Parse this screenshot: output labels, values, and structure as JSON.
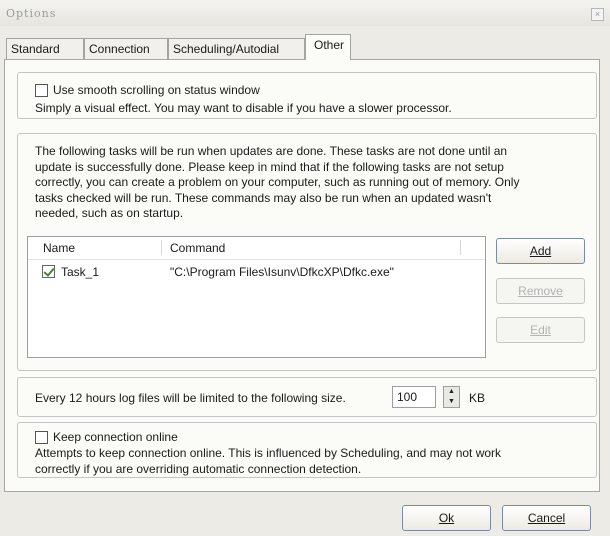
{
  "window": {
    "title": "Options",
    "close_glyph": "×"
  },
  "tabs": [
    {
      "label": "Standard"
    },
    {
      "label": "Connection"
    },
    {
      "label": "Scheduling/Autodial"
    },
    {
      "label": "Other",
      "active": true
    }
  ],
  "smooth_scroll": {
    "label": "Use smooth scrolling on status window",
    "checked": false,
    "description": "Simply a visual effect.  You may want to disable if you have a slower processor."
  },
  "tasks": {
    "description_1": "The following tasks will be run when updates are done.  These tasks are not done until an",
    "description_2": "update is successfully done.  Please keep in mind that if the following tasks are not setup",
    "description_3": "correctly, you can create a problem on your computer, such as running out of memory.  Only",
    "description_4": "tasks checked will be run.  These commands may also be run when an updated wasn't",
    "description_5": "needed, such as on startup.",
    "columns": {
      "name": "Name",
      "command": "Command"
    },
    "rows": [
      {
        "name": "Task_1",
        "command": "\"C:\\Program Files\\Isunv\\DfkcXP\\Dfkc.exe\"",
        "checked": true
      }
    ],
    "buttons": {
      "add": "Add",
      "remove": "Remove",
      "edit": "Edit"
    }
  },
  "log": {
    "label": "Every 12 hours log files will be limited to the following size.",
    "value": "100",
    "unit": "KB"
  },
  "keep_online": {
    "label": "Keep connection online",
    "checked": false,
    "description_1": "Attempts to keep connection online.  This is influenced by Scheduling, and may not work",
    "description_2": "correctly if you are overriding automatic connection detection."
  },
  "footer": {
    "ok": "Ok",
    "cancel": "Cancel"
  }
}
